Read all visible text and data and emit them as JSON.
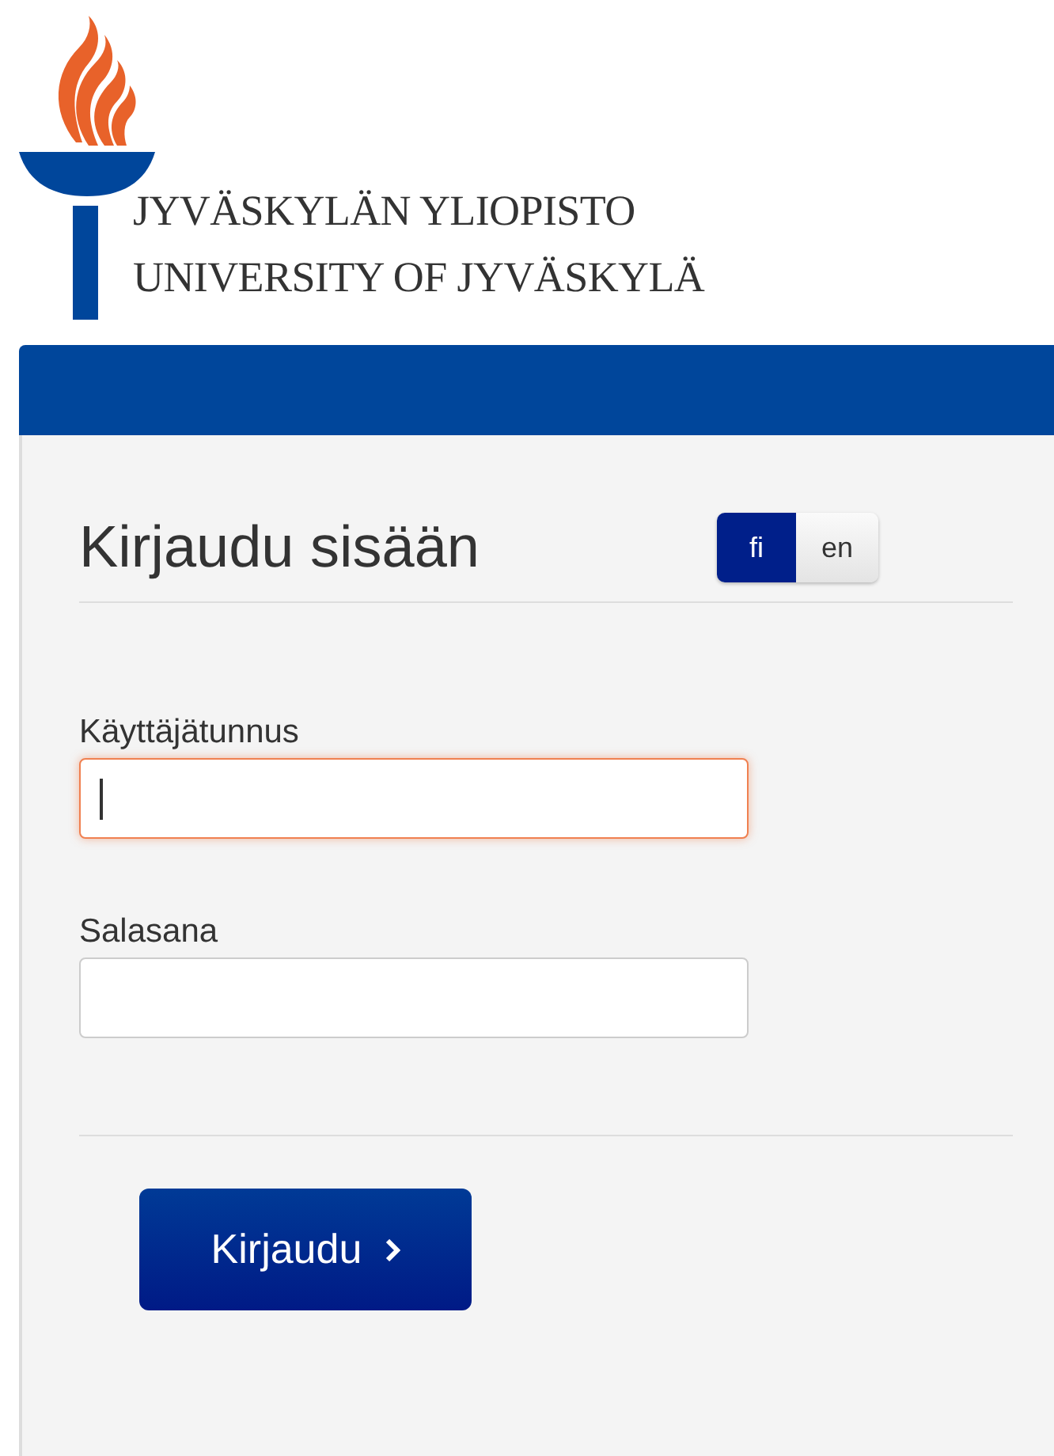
{
  "logo": {
    "lines": [
      "JYVÄSKYLÄN YLIOPISTO",
      "UNIVERSITY OF JYVÄSKYLÄ"
    ]
  },
  "login": {
    "title": "Kirjaudu sisään",
    "languages": [
      {
        "label": "fi",
        "selected": true
      },
      {
        "label": "en",
        "selected": false
      }
    ],
    "fields": [
      {
        "label": "Käyttäjätunnus",
        "focused": true
      },
      {
        "label": "Salasana",
        "focused": false
      }
    ],
    "submit": {
      "label": "Kirjaudu"
    }
  }
}
